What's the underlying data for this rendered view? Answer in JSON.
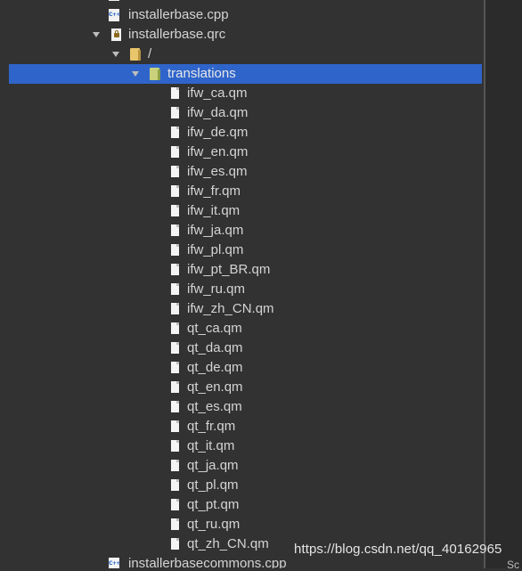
{
  "tree": {
    "top_partial": {
      "icon": "cpp-icon",
      "label": ""
    },
    "rows": [
      {
        "label": "installerbase.cpp",
        "icon": "cpp-file-icon",
        "arrow": false
      },
      {
        "label": "installerbase.qrc",
        "icon": "qrc-file-icon",
        "arrow": true
      },
      {
        "label": "/",
        "icon": "folder-icon",
        "arrow": true
      },
      {
        "label": "translations",
        "icon": "folder-icon",
        "arrow": true,
        "selected": true
      },
      {
        "label": "ifw_ca.qm",
        "icon": "file-icon"
      },
      {
        "label": "ifw_da.qm",
        "icon": "file-icon"
      },
      {
        "label": "ifw_de.qm",
        "icon": "file-icon"
      },
      {
        "label": "ifw_en.qm",
        "icon": "file-icon"
      },
      {
        "label": "ifw_es.qm",
        "icon": "file-icon"
      },
      {
        "label": "ifw_fr.qm",
        "icon": "file-icon"
      },
      {
        "label": "ifw_it.qm",
        "icon": "file-icon"
      },
      {
        "label": "ifw_ja.qm",
        "icon": "file-icon"
      },
      {
        "label": "ifw_pl.qm",
        "icon": "file-icon"
      },
      {
        "label": "ifw_pt_BR.qm",
        "icon": "file-icon"
      },
      {
        "label": "ifw_ru.qm",
        "icon": "file-icon"
      },
      {
        "label": "ifw_zh_CN.qm",
        "icon": "file-icon"
      },
      {
        "label": "qt_ca.qm",
        "icon": "file-icon"
      },
      {
        "label": "qt_da.qm",
        "icon": "file-icon"
      },
      {
        "label": "qt_de.qm",
        "icon": "file-icon"
      },
      {
        "label": "qt_en.qm",
        "icon": "file-icon"
      },
      {
        "label": "qt_es.qm",
        "icon": "file-icon"
      },
      {
        "label": "qt_fr.qm",
        "icon": "file-icon"
      },
      {
        "label": "qt_it.qm",
        "icon": "file-icon"
      },
      {
        "label": "qt_ja.qm",
        "icon": "file-icon"
      },
      {
        "label": "qt_pl.qm",
        "icon": "file-icon"
      },
      {
        "label": "qt_pt.qm",
        "icon": "file-icon"
      },
      {
        "label": "qt_ru.qm",
        "icon": "file-icon"
      },
      {
        "label": "qt_zh_CN.qm",
        "icon": "file-icon"
      },
      {
        "label": "installerbasecommons.cpp",
        "icon": "cpp-file-icon",
        "arrow": false
      }
    ]
  },
  "right_pane": {
    "text": "Sc"
  },
  "watermark": "https://blog.csdn.net/qq_40162965",
  "colors": {
    "background": "#323232",
    "selection": "#2f65ca",
    "text": "#d4d4d4"
  }
}
